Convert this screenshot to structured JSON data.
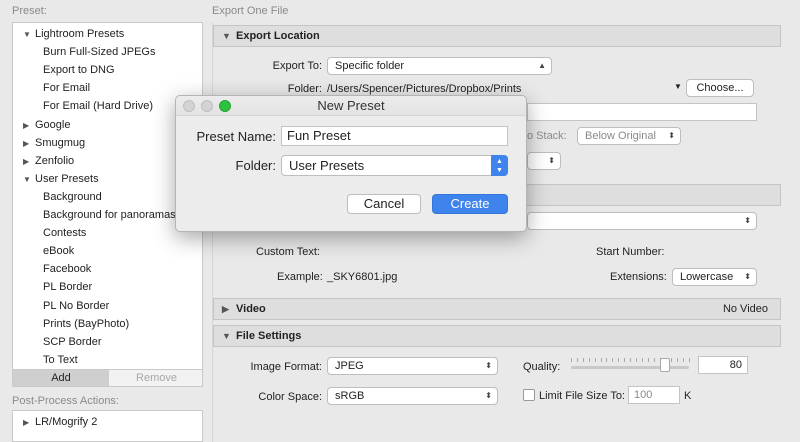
{
  "left": {
    "preset_label": "Preset:",
    "tree": [
      {
        "label": "Lightroom Presets",
        "kind": "folder",
        "expanded": true
      },
      {
        "label": "Burn Full-Sized JPEGs",
        "kind": "item"
      },
      {
        "label": "Export to DNG",
        "kind": "item"
      },
      {
        "label": "For Email",
        "kind": "item"
      },
      {
        "label": "For Email (Hard Drive)",
        "kind": "item"
      },
      {
        "label": "Google",
        "kind": "folder",
        "expanded": false
      },
      {
        "label": "Smugmug",
        "kind": "folder",
        "expanded": false
      },
      {
        "label": "Zenfolio",
        "kind": "folder",
        "expanded": false
      },
      {
        "label": "User Presets",
        "kind": "folder",
        "expanded": true
      },
      {
        "label": "Background",
        "kind": "item"
      },
      {
        "label": "Background for panoramas",
        "kind": "item"
      },
      {
        "label": "Contests",
        "kind": "item"
      },
      {
        "label": "eBook",
        "kind": "item"
      },
      {
        "label": "Facebook",
        "kind": "item"
      },
      {
        "label": "PL Border",
        "kind": "item"
      },
      {
        "label": "PL No Border",
        "kind": "item"
      },
      {
        "label": "Prints (BayPhoto)",
        "kind": "item"
      },
      {
        "label": "SCP Border",
        "kind": "item"
      },
      {
        "label": "To Text",
        "kind": "item"
      }
    ],
    "add_label": "Add",
    "remove_label": "Remove",
    "post_process_label": "Post-Process Actions:",
    "post_process_items": [
      {
        "label": "LR/Mogrify 2",
        "kind": "folder",
        "expanded": false
      }
    ]
  },
  "right": {
    "header": "Export One File",
    "export_location": {
      "title": "Export Location",
      "export_to_label": "Export To:",
      "export_to_value": "Specific folder",
      "folder_label": "Folder:",
      "folder_path": "/Users/Spencer/Pictures/Dropbox/Prints",
      "choose_label": "Choose...",
      "stack_label": "o Stack:",
      "stack_value": "Below Original"
    },
    "file_naming": {
      "custom_text_label": "Custom Text:",
      "start_number_label": "Start Number:",
      "example_label": "Example:",
      "example_value": "_SKY6801.jpg",
      "extensions_label": "Extensions:",
      "extensions_value": "Lowercase"
    },
    "video": {
      "title": "Video",
      "status": "No Video"
    },
    "file_settings": {
      "title": "File Settings",
      "image_format_label": "Image Format:",
      "image_format_value": "JPEG",
      "quality_label": "Quality:",
      "quality_value": "80",
      "quality_level": 80,
      "color_space_label": "Color Space:",
      "color_space_value": "sRGB",
      "limit_label": "Limit File Size To:",
      "limit_value": "100",
      "limit_unit": "K"
    }
  },
  "modal": {
    "title": "New Preset",
    "preset_name_label": "Preset Name:",
    "preset_name_value": "Fun Preset",
    "folder_label": "Folder:",
    "folder_value": "User Presets",
    "cancel_label": "Cancel",
    "create_label": "Create",
    "accent_color": "#3f83ec"
  }
}
